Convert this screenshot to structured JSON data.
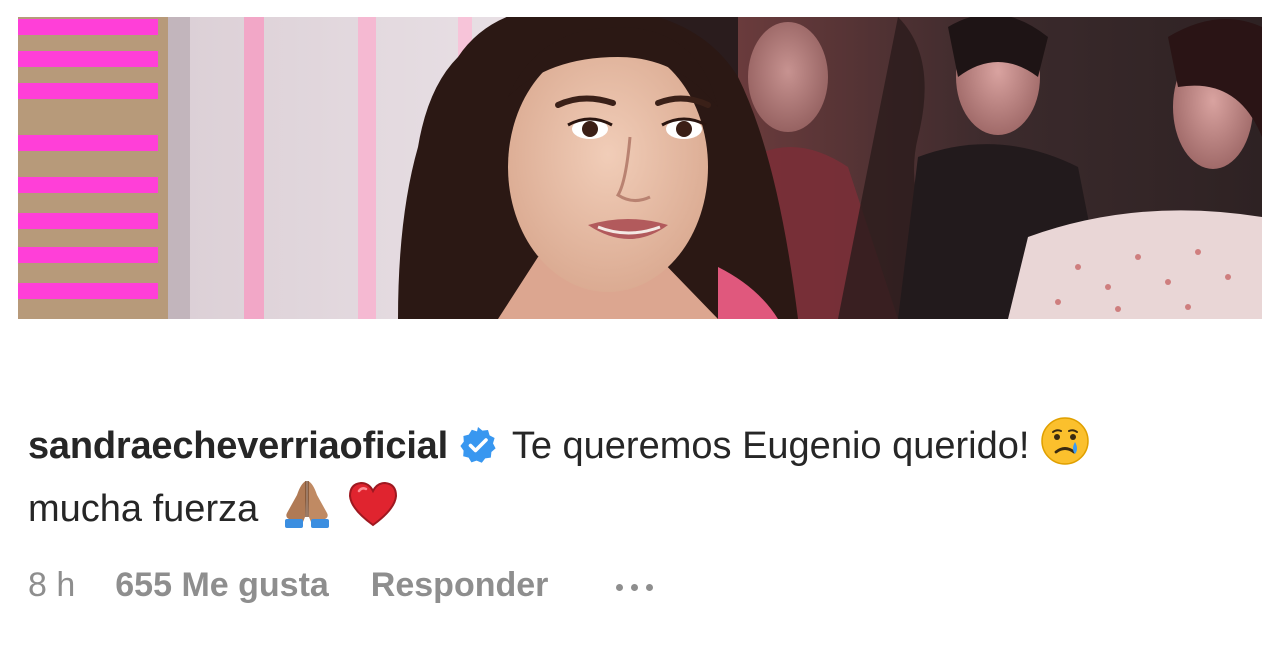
{
  "post": {
    "image_description_icon": "profile-photo",
    "comment": {
      "username": "sandraecheverriaoficial",
      "verified_icon": "verified-badge-icon",
      "text_line1": "Te queremos Eugenio querido!",
      "emoji_crying": "crying-face-icon",
      "text_line2": "mucha fuerza",
      "emoji_pray": "folded-hands-icon",
      "emoji_heart": "red-heart-icon"
    },
    "meta": {
      "time": "8 h",
      "likes": "655 Me gusta",
      "reply_label": "Responder",
      "more_icon": "more-options-icon"
    }
  },
  "colors": {
    "text": "#262626",
    "muted": "#8e8e8e",
    "verified": "#3897f0",
    "heart": "#e0242f"
  }
}
